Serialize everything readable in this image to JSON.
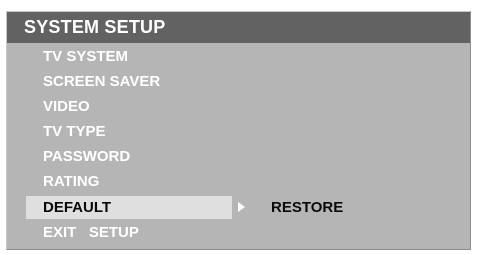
{
  "panel": {
    "title": "SYSTEM SETUP"
  },
  "menu": {
    "items": [
      {
        "label": "TV SYSTEM"
      },
      {
        "label": "SCREEN SAVER"
      },
      {
        "label": "VIDEO"
      },
      {
        "label": "TV TYPE"
      },
      {
        "label": "PASSWORD"
      },
      {
        "label": "RATING"
      },
      {
        "label": "DEFAULT",
        "selected": true,
        "sub_value": "RESTORE"
      },
      {
        "label": "EXIT   SETUP"
      }
    ]
  },
  "colors": {
    "panel_bg": "#b5b5b5",
    "header_bg": "#626262",
    "highlight_bg": "#dfdfdf",
    "text": "#ffffff",
    "selected_text": "#0a0a0a"
  },
  "icons": {
    "submenu_indicator": "triangle-right-icon"
  }
}
